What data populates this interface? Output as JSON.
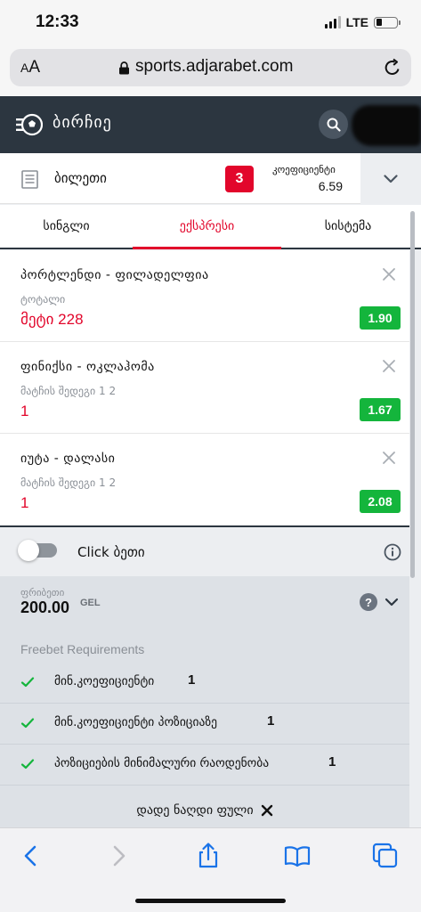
{
  "status_bar": {
    "time": "12:33",
    "network": "LTE",
    "signal_bars": 4,
    "signal_bars_filled": 3,
    "battery_level": 0.2
  },
  "browser": {
    "text_size_label_small": "A",
    "text_size_label_large": "A",
    "url": "sports.adjarabet.com",
    "icons": [
      "lock-icon",
      "reload-icon"
    ]
  },
  "app_header": {
    "title": "ბირჩიე",
    "logo_icon": "soccer-ball-menu-icon",
    "search_icon": "search-icon"
  },
  "bet_slip": {
    "label": "ბილეთი",
    "count": "3",
    "coef_label": "კოეფიციენტი",
    "coef_value": "6.59",
    "collapse_icon": "chevron-down-icon"
  },
  "tabs": [
    {
      "label": "სინგლი",
      "active": false
    },
    {
      "label": "ექსპრესი",
      "active": true
    },
    {
      "label": "სისტემა",
      "active": false
    }
  ],
  "bets": [
    {
      "title": "პორტლენდი - ფილადელფია",
      "market": "ტოტალი",
      "pick": "მეტი 228",
      "odd": "1.90"
    },
    {
      "title": "ფინიქსი - ოკლაჰომა",
      "market": "მატჩის შედეგი 1 2",
      "pick": "1",
      "odd": "1.67"
    },
    {
      "title": "იუტა - დალასი",
      "market": "მატჩის შედეგი 1 2",
      "pick": "1",
      "odd": "2.08"
    }
  ],
  "click_bet": {
    "label": "Click ბეთი",
    "enabled": false
  },
  "freebet": {
    "label": "ფრიბეთი",
    "amount": "200.00",
    "currency": "GEL",
    "help": "?",
    "requirements_title": "Freebet Requirements",
    "requirements": [
      {
        "label": "მინ.კოეფიციენტი",
        "value": "1"
      },
      {
        "label": "მინ.კოეფიციენტი პოზიციაზე",
        "value": "1"
      },
      {
        "label": "პოზიციების მინიმალური რაოდენობა",
        "value": "1"
      }
    ],
    "cash_label": "დადე ნაღდი ფული"
  },
  "colors": {
    "header_bg": "#2c3640",
    "accent_red": "#e2062b",
    "odd_green": "#14b53c",
    "ios_blue": "#1a73e8"
  }
}
